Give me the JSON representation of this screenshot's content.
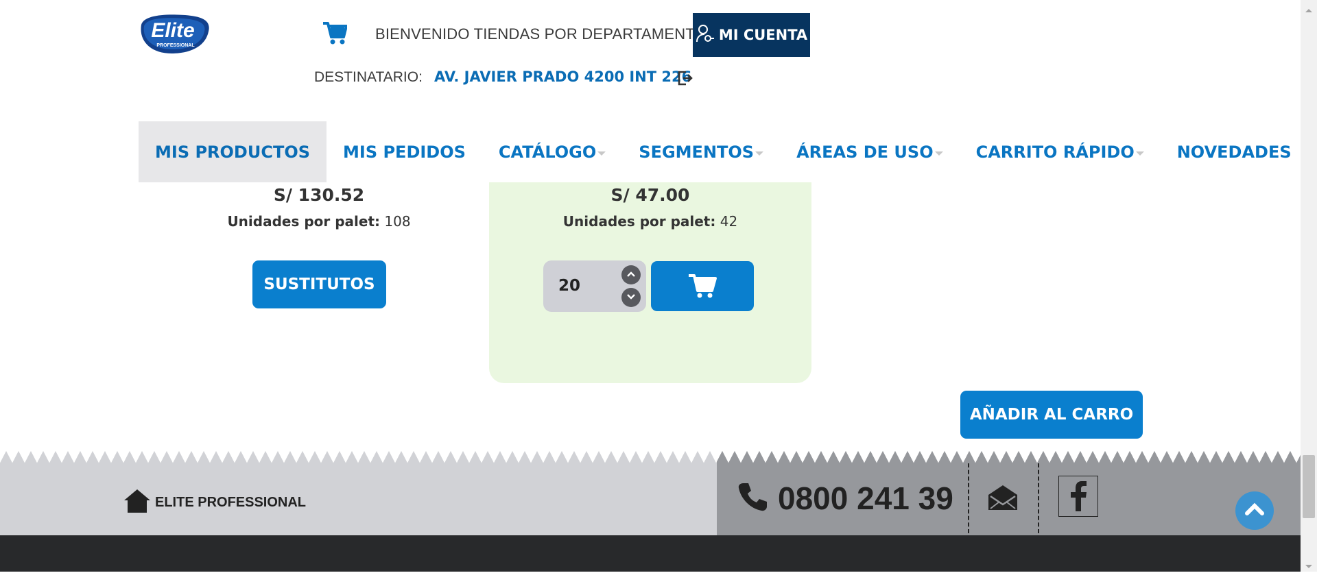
{
  "header": {
    "logo_text": "Elite",
    "logo_sub": "PROFESSIONAL",
    "welcome": "BIENVENIDO TIENDAS POR DEPARTAMENTO",
    "account_label": "MI CUENTA",
    "destination_label": "DESTINATARIO:",
    "destination_value": "AV. JAVIER PRADO 4200 INT 226"
  },
  "nav": {
    "items": [
      {
        "label": "MIS PRODUCTOS"
      },
      {
        "label": "MIS PEDIDOS"
      },
      {
        "label": "CATÁLOGO"
      },
      {
        "label": "SEGMENTOS"
      },
      {
        "label": "ÁREAS DE USO"
      },
      {
        "label": "CARRITO RÁPIDO"
      },
      {
        "label": "NOVEDADES"
      }
    ]
  },
  "products": [
    {
      "price": "S/ 130.52",
      "units_label": "Unidades por palet:",
      "units_value": "108",
      "button": "SUSTITUTOS"
    },
    {
      "price": "S/ 47.00",
      "units_label": "Unidades por palet:",
      "units_value": "42",
      "quantity": "20"
    }
  ],
  "add_to_cart_label": "AÑADIR AL CARRO",
  "footer": {
    "home_label": "ELITE PROFESSIONAL",
    "phone": "0800 241 39"
  },
  "colors": {
    "nav_blue": "#0a75c2",
    "button_blue": "#0a7fce",
    "account_bg": "#07345f",
    "card_green": "#eaf7e0"
  }
}
